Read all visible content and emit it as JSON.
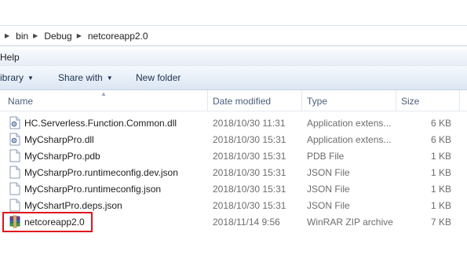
{
  "breadcrumb": {
    "items": [
      "bin",
      "Debug",
      "netcoreapp2.0"
    ]
  },
  "menubar": {
    "items": [
      "Help"
    ]
  },
  "toolbar": {
    "library_label": "ibrary",
    "share_label": "Share with",
    "new_folder_label": "New folder"
  },
  "columns": {
    "name": "Name",
    "date": "Date modified",
    "type": "Type",
    "size": "Size"
  },
  "files": [
    {
      "name": "HC.Serverless.Function.Common.dll",
      "date": "2018/10/30 11:31",
      "type": "Application extens...",
      "size": "6 KB",
      "icon": "dll-icon"
    },
    {
      "name": "MyCsharpPro.dll",
      "date": "2018/10/30 15:31",
      "type": "Application extens...",
      "size": "6 KB",
      "icon": "dll-icon"
    },
    {
      "name": "MyCsharpPro.pdb",
      "date": "2018/10/30 15:31",
      "type": "PDB File",
      "size": "1 KB",
      "icon": "file-icon"
    },
    {
      "name": "MyCsharpPro.runtimeconfig.dev.json",
      "date": "2018/10/30 15:31",
      "type": "JSON File",
      "size": "1 KB",
      "icon": "file-icon"
    },
    {
      "name": "MyCsharpPro.runtimeconfig.json",
      "date": "2018/10/30 15:31",
      "type": "JSON File",
      "size": "1 KB",
      "icon": "file-icon"
    },
    {
      "name": "MyCshartPro.deps.json",
      "date": "2018/10/30 15:31",
      "type": "JSON File",
      "size": "1 KB",
      "icon": "file-icon"
    },
    {
      "name": "netcoreapp2.0",
      "date": "2018/11/14 9:56",
      "type": "WinRAR ZIP archive",
      "size": "7 KB",
      "icon": "winrar-archive-icon"
    }
  ],
  "colors": {
    "highlight": "#e0141e",
    "header_text": "#4c607a",
    "meta_text": "#6d6d6d"
  }
}
